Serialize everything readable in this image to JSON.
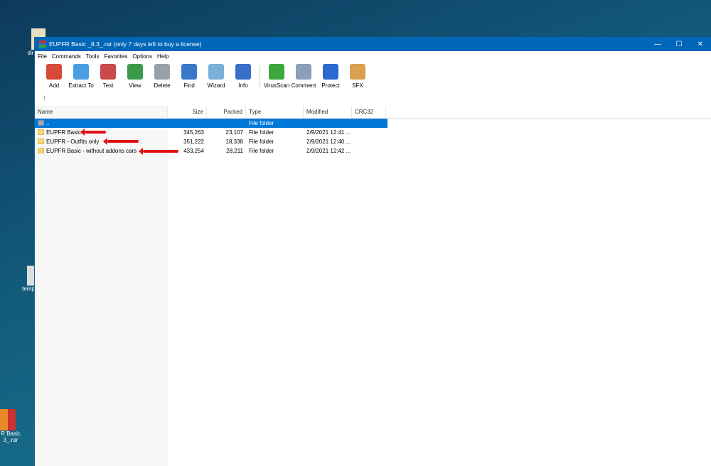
{
  "window": {
    "title": "EUPFR Basic _8.3_.rar (only 7 days left to buy a license)",
    "minimize": "—",
    "maximize": "☐",
    "close": "✕"
  },
  "menu": [
    "File",
    "Commands",
    "Tools",
    "Favorites",
    "Options",
    "Help"
  ],
  "toolbar": [
    {
      "label": "Add",
      "color": "#d9493a"
    },
    {
      "label": "Extract To",
      "color": "#4a9de0"
    },
    {
      "label": "Test",
      "color": "#c84a4a"
    },
    {
      "label": "View",
      "color": "#3a9a4a"
    },
    {
      "label": "Delete",
      "color": "#9aa0a8"
    },
    {
      "label": "Find",
      "color": "#3a78c8"
    },
    {
      "label": "Wizard",
      "color": "#7ab0d8"
    },
    {
      "label": "Info",
      "color": "#3a6fc8"
    },
    {
      "label": "VirusScan",
      "color": "#3aa83a"
    },
    {
      "label": "Comment",
      "color": "#8aa0b8"
    },
    {
      "label": "Protect",
      "color": "#2a6ad0"
    },
    {
      "label": "SFX",
      "color": "#d8a050"
    }
  ],
  "up_icon": "↑",
  "columns": [
    "Name",
    "Size",
    "Packed",
    "Type",
    "Modified",
    "CRC32"
  ],
  "rows": [
    {
      "name": "..",
      "size": "",
      "packed": "",
      "type": "File folder",
      "modified": "",
      "selected": true
    },
    {
      "name": "EUPFR  Basic",
      "size": "345,263",
      "packed": "23,107",
      "type": "File folder",
      "modified": "2/9/2021 12:41 ..."
    },
    {
      "name": "EUPFR - Outfits only",
      "size": "351,222",
      "packed": "18,338",
      "type": "File folder",
      "modified": "2/9/2021 12:40 ..."
    },
    {
      "name": "EUPFR Basic - without addons cars",
      "size": "433,254",
      "packed": "28,211",
      "type": "File folder",
      "modified": "2/9/2021 12:42 ..."
    }
  ],
  "desktop": {
    "icon1": "dir",
    "icon2": "temp",
    "icon3_line1": "R Basic",
    "icon3_line2": "3_.rar"
  }
}
